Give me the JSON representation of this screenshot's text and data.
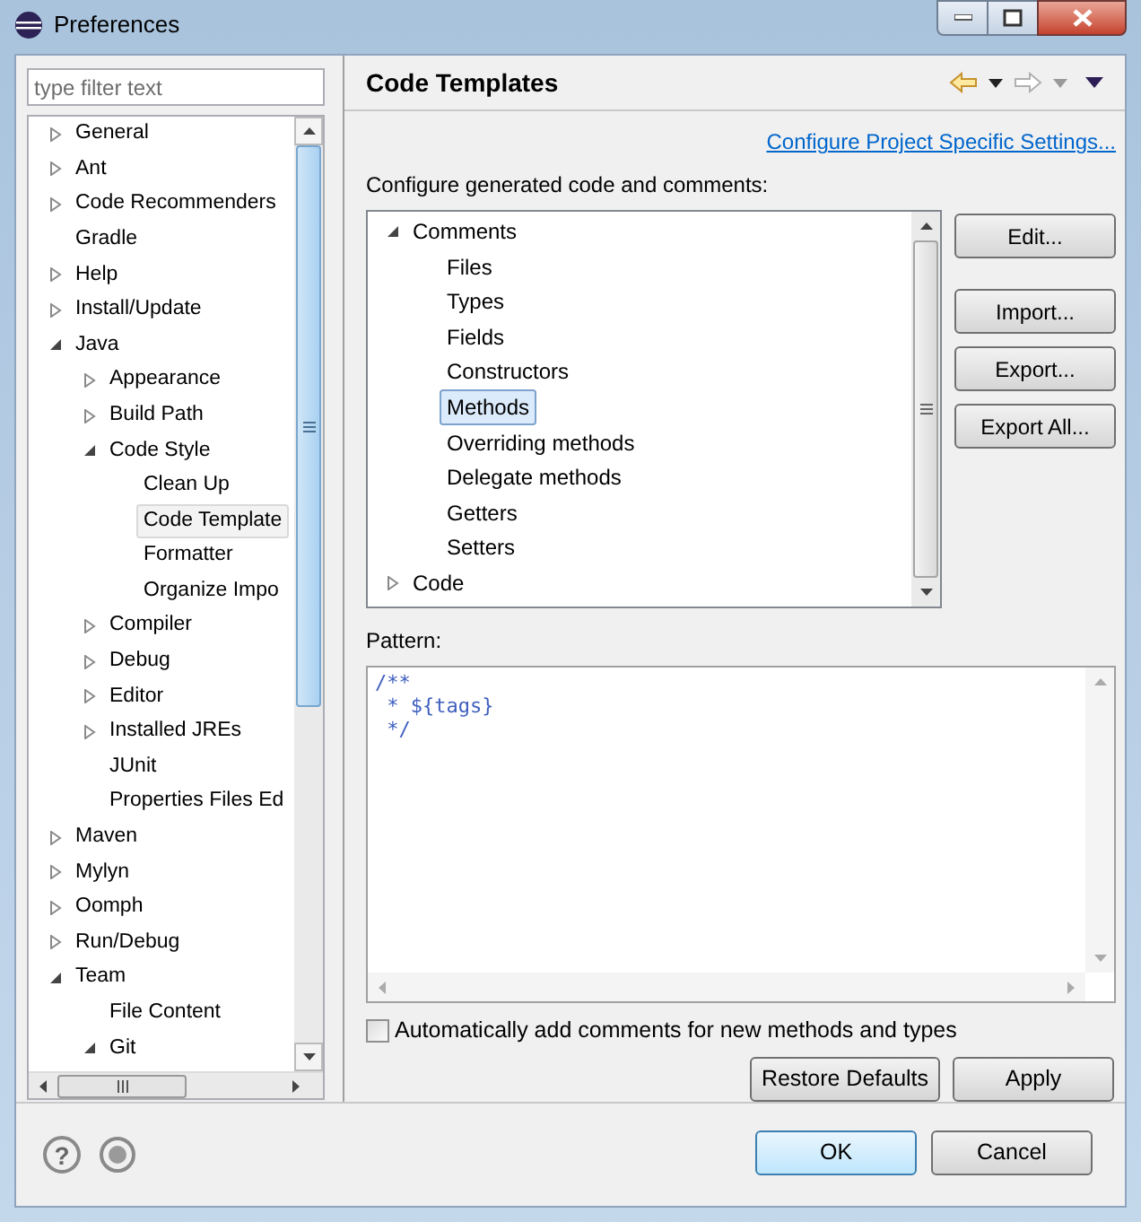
{
  "window": {
    "title": "Preferences"
  },
  "filter": {
    "placeholder": "type filter text"
  },
  "nav_tree": [
    {
      "label": "General",
      "expanded": false,
      "selected": false
    },
    {
      "label": "Ant",
      "expanded": false,
      "selected": false
    },
    {
      "label": "Code Recommenders",
      "expanded": false,
      "selected": false
    },
    {
      "label": "Gradle",
      "selected": false
    },
    {
      "label": "Help",
      "expanded": false,
      "selected": false
    },
    {
      "label": "Install/Update",
      "expanded": false,
      "selected": false
    },
    {
      "label": "Java",
      "expanded": true,
      "selected": false,
      "children": [
        {
          "label": "Appearance",
          "expanded": false,
          "selected": false
        },
        {
          "label": "Build Path",
          "expanded": false,
          "selected": false
        },
        {
          "label": "Code Style",
          "expanded": true,
          "selected": false,
          "children": [
            {
              "label": "Clean Up",
              "selected": false
            },
            {
              "label": "Code Template",
              "selected": true
            },
            {
              "label": "Formatter",
              "selected": false
            },
            {
              "label": "Organize Impo",
              "selected": false
            }
          ]
        },
        {
          "label": "Compiler",
          "expanded": false,
          "selected": false
        },
        {
          "label": "Debug",
          "expanded": false,
          "selected": false
        },
        {
          "label": "Editor",
          "expanded": false,
          "selected": false
        },
        {
          "label": "Installed JREs",
          "expanded": false,
          "selected": false
        },
        {
          "label": "JUnit",
          "selected": false
        },
        {
          "label": "Properties Files Ed",
          "selected": false
        }
      ]
    },
    {
      "label": "Maven",
      "expanded": false,
      "selected": false
    },
    {
      "label": "Mylyn",
      "expanded": false,
      "selected": false
    },
    {
      "label": "Oomph",
      "expanded": false,
      "selected": false
    },
    {
      "label": "Run/Debug",
      "expanded": false,
      "selected": false
    },
    {
      "label": "Team",
      "expanded": true,
      "selected": false,
      "children": [
        {
          "label": "File Content",
          "selected": false
        },
        {
          "label": "Git",
          "expanded": true,
          "selected": false
        }
      ]
    }
  ],
  "page": {
    "title": "Code Templates",
    "link": "Configure Project Specific Settings...",
    "description": "Configure generated code and comments:",
    "templates": [
      {
        "label": "Comments",
        "expanded": true,
        "selected": false,
        "children": [
          {
            "label": "Files",
            "selected": false
          },
          {
            "label": "Types",
            "selected": false
          },
          {
            "label": "Fields",
            "selected": false
          },
          {
            "label": "Constructors",
            "selected": false
          },
          {
            "label": "Methods",
            "selected": true
          },
          {
            "label": "Overriding methods",
            "selected": false
          },
          {
            "label": "Delegate methods",
            "selected": false
          },
          {
            "label": "Getters",
            "selected": false
          },
          {
            "label": "Setters",
            "selected": false
          }
        ]
      },
      {
        "label": "Code",
        "expanded": false,
        "selected": false
      }
    ],
    "side_buttons": [
      "Edit...",
      "Import...",
      "Export...",
      "Export All..."
    ],
    "pattern_label": "Pattern:",
    "pattern": [
      "/**",
      " * ${tags}",
      " */"
    ],
    "auto_comments": {
      "label": "Automatically add comments for new methods and types",
      "checked": false
    },
    "buttons": [
      "Restore Defaults",
      "Apply"
    ]
  },
  "footer": {
    "help": "?",
    "buttons": [
      {
        "label": "OK",
        "default": true
      },
      {
        "label": "Cancel",
        "default": false
      }
    ]
  }
}
